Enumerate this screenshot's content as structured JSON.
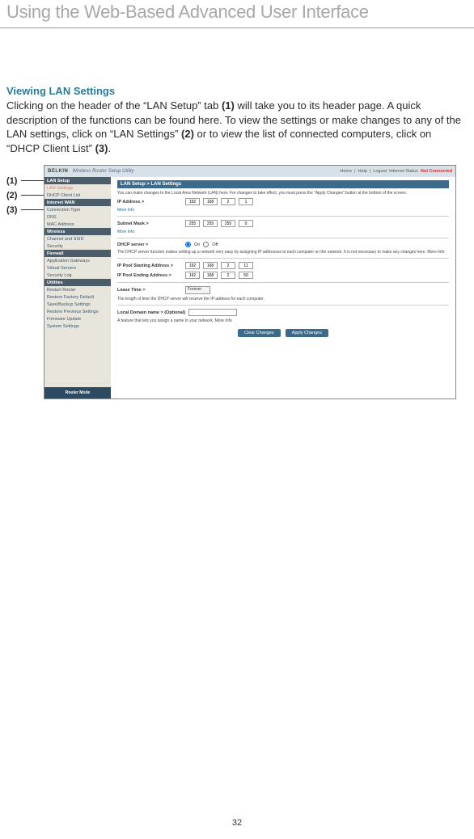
{
  "page": {
    "header": "Using the Web-Based Advanced User Interface",
    "section_heading": "Viewing LAN Settings",
    "body_parts": {
      "p1a": "Clicking on the header of the “LAN Setup” tab ",
      "ref1": "(1)",
      "p1b": " will take you to its header page. A quick description of the functions can be found here. To view the settings or make changes to any of the LAN settings, click on “LAN Settings” ",
      "ref2": "(2)",
      "p1c": " or to view the list of connected computers, click on “DHCP Client List” ",
      "ref3": "(3)",
      "p1d": "."
    },
    "callouts": {
      "c1": "(1)",
      "c2": "(2)",
      "c3": "(3)"
    },
    "page_number": "32"
  },
  "screenshot": {
    "brand": "BELKIN",
    "title": "Wireless Router Setup Utility",
    "topnav": [
      "Home",
      "Help",
      "Logout",
      "Internet Status"
    ],
    "topnav_status": "Not Connected",
    "sidebar": {
      "cat_lan": "LAN Setup",
      "lan_items": [
        "LAN Settings",
        "DHCP Client List"
      ],
      "cat_wan": "Internet WAN",
      "wan_items": [
        "Connection Type",
        "DNS",
        "MAC Address"
      ],
      "cat_wireless": "Wireless",
      "wireless_items": [
        "Channel and SSID",
        "Security"
      ],
      "cat_firewall": "Firewall",
      "fw_items": [
        "Application Gateways",
        "Virtual Servers",
        "Security Log"
      ],
      "cat_utilities": "Utilities",
      "util_items": [
        "Restart Router",
        "Restore Factory Default",
        "Save/Backup Settings",
        "Restore Previous Settings",
        "Firmware Update",
        "System Settings"
      ],
      "footer": "Router Mode"
    },
    "main": {
      "header": "LAN Setup > LAN Settings",
      "intro": "You can make changes to the Local Area Network (LAN) here. For changes to take effect, you must press the \"Apply Changes\" button at the bottom of the screen.",
      "ip_label": "IP Address >",
      "ip": [
        "192",
        "168",
        "2",
        "1"
      ],
      "more_info": "More Info",
      "subnet_label": "Subnet Mask >",
      "subnet": [
        "255",
        "255",
        "255",
        "0"
      ],
      "dhcp_label": "DHCP server >",
      "dhcp_on": "On",
      "dhcp_off": "Off",
      "dhcp_desc": "The DHCP server function makes setting up a network very easy by assigning IP addresses to each computer on the network. It is not necessary to make any changes here. More Info",
      "pool_start_label": "IP Pool Starting Address >",
      "pool_start": [
        "192",
        "168",
        "2",
        "11"
      ],
      "pool_end_label": "IP Pool Ending Address >",
      "pool_end": [
        "192",
        "168",
        "2",
        "50"
      ],
      "lease_label": "Lease Time >",
      "lease_value": "Forever",
      "lease_desc": "The length of time the DHCP server will reserve the IP address for each computer.",
      "domain_label": "Local Domain name > (Optional)",
      "domain_desc": "A feature that lets you assign a name to your network. More Info",
      "btn_clear": "Clear Changes",
      "btn_apply": "Apply Changes"
    }
  }
}
